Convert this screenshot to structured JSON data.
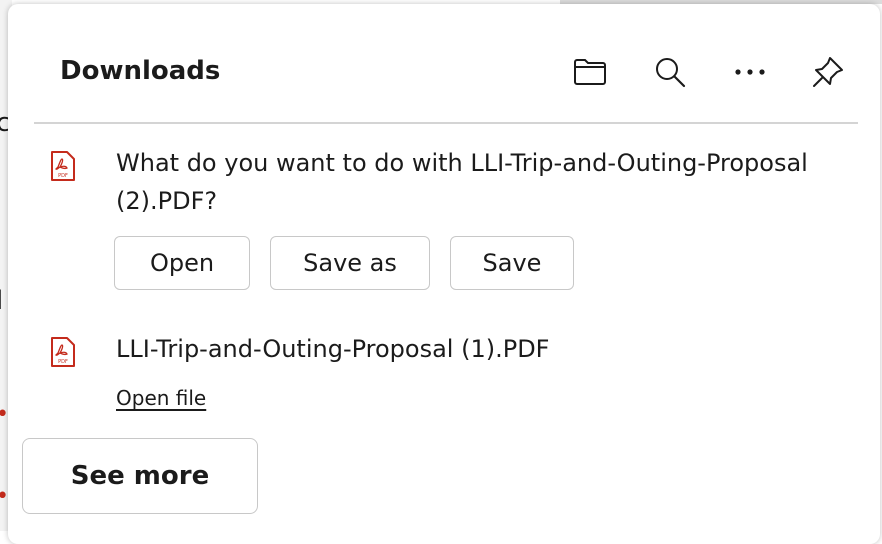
{
  "panel": {
    "title": "Downloads",
    "header_icons": [
      "folder-icon",
      "search-icon",
      "more-icon",
      "pin-icon"
    ]
  },
  "downloads": [
    {
      "prompt": "What do you want to do with LLI-Trip-and-Outing-Proposal (2).PDF?",
      "icon": "pdf-icon",
      "icon_label": "PDF",
      "actions": [
        "Open",
        "Save as",
        "Save"
      ]
    },
    {
      "filename": "LLI-Trip-and-Outing-Proposal (1).PDF",
      "icon": "pdf-icon",
      "icon_label": "PDF",
      "action": "Open file"
    }
  ],
  "footer": {
    "see_more_label": "See more"
  },
  "colors": {
    "pdf_red": "#c42b1c",
    "text": "#1b1b1b",
    "border": "#c8c8c8"
  }
}
